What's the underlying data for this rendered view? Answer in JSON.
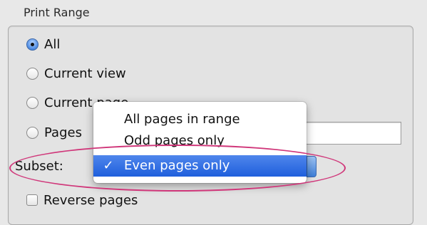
{
  "group_title": "Print Range",
  "options": [
    {
      "label": "All",
      "selected": true
    },
    {
      "label": "Current view",
      "selected": false
    },
    {
      "label": "Current page",
      "selected": false
    },
    {
      "label": "Pages",
      "selected": false
    }
  ],
  "subset": {
    "label": "Subset:",
    "menu": [
      {
        "label": "All pages in range",
        "checked": false
      },
      {
        "label": "Odd pages only",
        "checked": false
      },
      {
        "label": "Even pages only",
        "checked": true
      }
    ],
    "check_mark": "✓"
  },
  "reverse_pages": {
    "label": "Reverse pages",
    "checked": false
  },
  "colors": {
    "highlight": "#1f5fdc",
    "annotation_ellipse": "#d0377a"
  }
}
